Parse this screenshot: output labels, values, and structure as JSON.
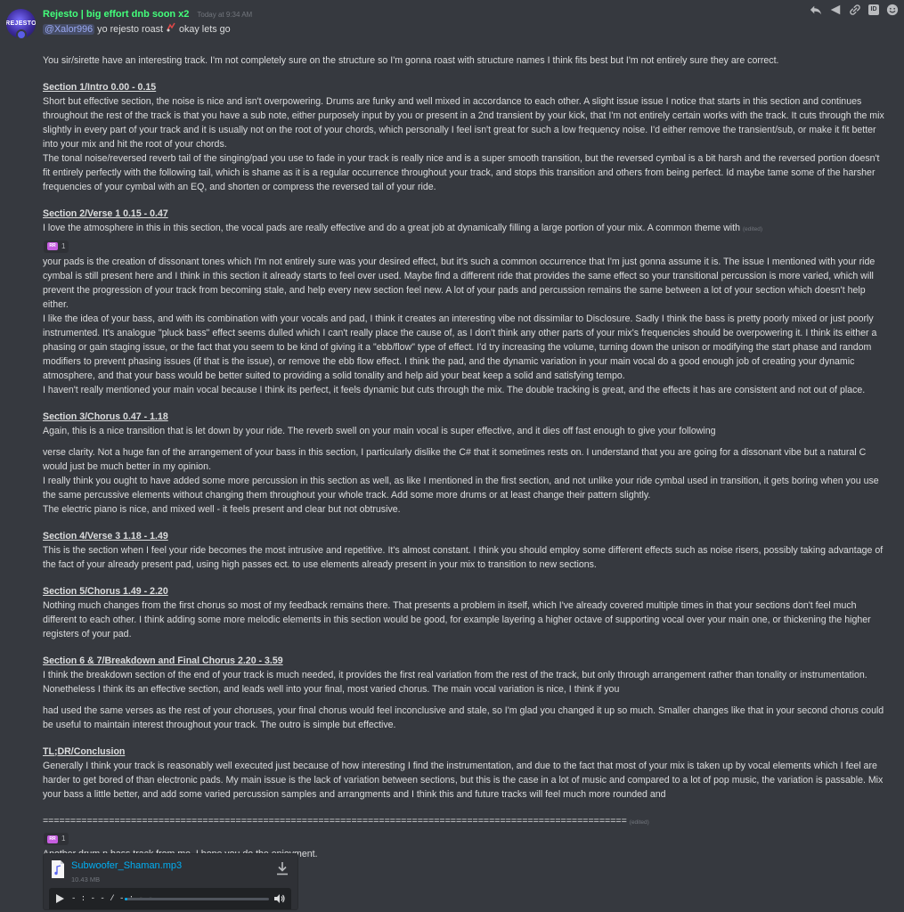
{
  "message": {
    "username": "Rejesto | big effort dnb soon x2",
    "timestamp": "Today at 9:34 AM",
    "avatar_text": "REJESTO",
    "mention": "@Xalor996",
    "first_line_rest": " yo rejesto roast ",
    "first_line_tail": " okay lets go"
  },
  "actions": [
    "reply-icon",
    "flag-icon",
    "link-icon",
    "id-icon",
    "emoji-icon"
  ],
  "actions_id_label": "ID",
  "body": {
    "intro": "You sir/sirette have an interesting track. I'm not completely sure on the structure so I'm gonna roast with structure names I think fits best but I'm not entirely sure they are correct.",
    "s1_heading": "Section 1/Intro 0.00 - 0.15",
    "s1_p1": "Short but effective section, the noise is nice and isn't overpowering. Drums are funky and well mixed in accordance to each other. A slight issue issue I notice that starts in this section and continues throughout the rest of the track is that you have a sub note, either purposely input by you or present in a 2nd transient by your kick, that I'm not entirely certain works with the track. It cuts through the mix slightly in every part of your track and it is usually not on the root of your chords, which personally I feel isn't great for such a low frequency noise. I'd either remove the transient/sub, or make it fit better into your mix and hit the root of your chords.",
    "s1_p2": "The tonal noise/reversed reverb tail of the singing/pad you use to fade in your track is really nice and is a super smooth transition, but the reversed cymbal is a bit harsh and the reversed portion doesn't fit entirely perfectly with the following tail, which is shame as it is a regular occurrence throughout your track, and stops this transition and others from being perfect. Id maybe tame some of the harsher frequencies of your cymbal with an EQ, and shorten or compress the reversed tail of your ride.",
    "s2_heading": "Section 2/Verse 1 0.15 - 0.47",
    "s2_p1": "I love the atmosphere in this in this section, the vocal pads are really effective and do a great job at dynamically filling a large portion of your mix. A common theme with",
    "edited": "(edited)",
    "reaction_count": "1",
    "reaction_emoji": "RR",
    "s2_p2": "your pads is the creation of dissonant tones which I'm not entirely sure was your desired effect, but it's such a common occurrence that I'm just gonna assume it is. The issue I mentioned with your ride cymbal is still present here and I think in this section it already starts to feel over used. Maybe find a different ride that provides the same effect so your transitional percussion is more varied, which will prevent the progression of your track from becoming stale, and help every new section feel new. A lot of your pads and percussion remains the same between a lot of your section which doesn't help either.",
    "s2_p3": "I like the idea of your bass, and with its combination with your vocals and pad, I think it creates an interesting vibe not dissimilar to Disclosure. Sadly I think the bass is pretty poorly mixed or just poorly instrumented. It's analogue \"pluck bass\" effect seems dulled which I can't really place the cause of, as I don't think any other parts of your mix's frequencies should be overpowering it. I think its either a phasing or gain staging issue, or the fact that you seem to be kind of giving it a \"ebb/flow\" type of effect. I'd try increasing the volume, turning down the unison or modifying the start phase and random modifiers to prevent phasing issues (if that is the issue), or remove the ebb flow effect. I think the pad, and the dynamic variation in your main vocal do a good enough job of creating your dynamic atmosphere, and that your bass would be better suited to providing a solid tonality and help aid your beat keep a solid and satisfying tempo.",
    "s2_p4": "I haven't really mentioned your main vocal because I think its perfect, it feels dynamic but cuts through the mix. The double tracking is great, and the effects it has are consistent and not out of place.",
    "s3_heading": "Section 3/Chorus 0.47 - 1.18",
    "s3_p1": "Again, this is a nice transition that is let down by your ride. The reverb swell on your main vocal is super effective, and it dies off fast enough to give your following",
    "s3_p2": "verse clarity. Not a huge fan of the arrangement of your bass in this section, I particularly dislike the C# that it sometimes rests on. I understand that you are going for a dissonant vibe but a natural C would just be much better in my opinion.",
    "s3_p3": "I really think you ought to have added some more percussion in this section as well, as like I mentioned in the first section, and not unlike your ride cymbal used in transition, it gets boring when you use the same percussive elements without changing them throughout your whole track. Add some more drums or at least change their pattern slightly.",
    "s3_p4": "The electric piano is nice, and mixed well - it feels present and clear but not obtrusive.",
    "s4_heading": "Section 4/Verse 3 1.18 - 1.49",
    "s4_p1": "This is the section when I feel your ride becomes the most intrusive and repetitive. It's almost constant. I think you should employ some different effects such as noise risers, possibly taking advantage of the fact of your already present pad, using high passes ect. to use elements already present in your mix to transition to new sections.",
    "s5_heading": "Section 5/Chorus 1.49 - 2.20",
    "s5_p1": "Nothing much changes from the first chorus so most of my feedback remains there. That presents a problem in itself, which I've already covered multiple times in that your sections don't feel much different to each other. I think adding some more melodic elements in this section would be good, for example layering a higher octave of supporting vocal over your main one, or thickening the higher registers of your pad.",
    "s6_heading": "Section 6 & 7/Breakdown and Final Chorus 2.20 - 3.59",
    "s6_p1": "I think the breakdown section of the end of your track is much needed, it provides the first real variation from the rest of the track, but only through arrangement rather than tonality or instrumentation.  Nonetheless I think its an effective section, and leads well into your final, most varied chorus. The main vocal variation is nice, I think if you",
    "s6_p2": "had used the same verses as the rest of your choruses, your final chorus would feel inconclusive and stale, so I'm glad you changed it up so much. Smaller changes like that in your second chorus could be useful to maintain interest throughout your track. The outro is simple but effective.",
    "c_heading": "TL;DR/Conclusion",
    "c_p1": "Generally I think your track is reasonably well executed just because of how interesting I find the instrumentation, and due to the fact that most of your mix is taken up by vocal elements which I feel are harder to get bored of than electronic pads. My main issue is the lack of variation between sections, but this is the case in a lot of music and compared to a lot of pop music, the variation is passable. Mix your bass a little better, and add some varied percussion samples and arrangments and I think this and future tracks will feel much more rounded and",
    "divider": "==========================================================================================================",
    "reaction2_count": "1",
    "reaction2_emoji": "RR",
    "closing": "Another drum n bass track from me, I hope you do the enjoyment."
  },
  "attachment": {
    "file_name": "Subwoofer_Shaman.mp3",
    "file_size": "10.43 MB",
    "time": "- : - - / - : - -",
    "progress_fraction": 0.01
  },
  "colors": {
    "background": "#36393f",
    "username": "#43ff7b",
    "link": "#00aff4",
    "text": "#dcddde"
  }
}
